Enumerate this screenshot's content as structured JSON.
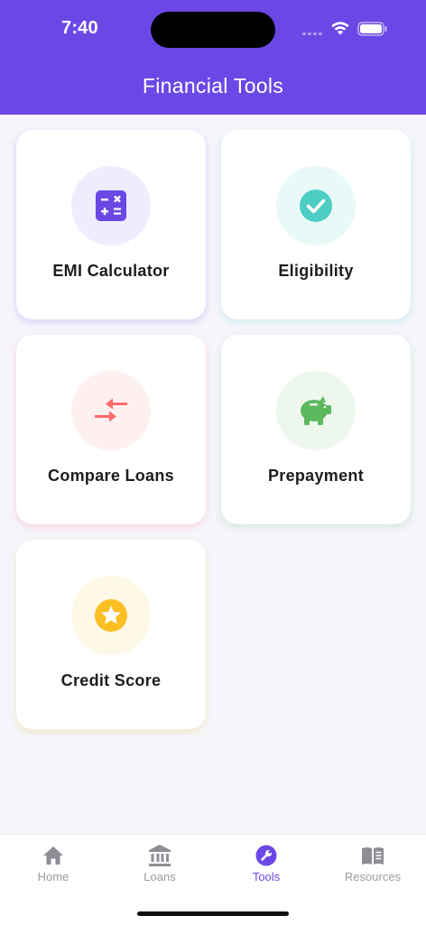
{
  "status_bar": {
    "time": "7:40"
  },
  "header": {
    "title": "Financial Tools"
  },
  "tools": [
    {
      "label": "EMI Calculator",
      "icon": "calculator-icon",
      "color": "#6b48e6",
      "bg": "#efecfd"
    },
    {
      "label": "Eligibility",
      "icon": "check-circle-icon",
      "color": "#4ecdc4",
      "bg": "#e8f9f7"
    },
    {
      "label": "Compare Loans",
      "icon": "compare-arrows-icon",
      "color": "#ff6b6b",
      "bg": "#fff0f0"
    },
    {
      "label": "Prepayment",
      "icon": "piggy-bank-icon",
      "color": "#5cb85c",
      "bg": "#edf7ed"
    },
    {
      "label": "Credit Score",
      "icon": "star-icon",
      "color": "#fbbf24",
      "bg": "#fef8e6"
    }
  ],
  "tab_bar": {
    "items": [
      {
        "label": "Home",
        "icon": "home-icon"
      },
      {
        "label": "Loans",
        "icon": "bank-icon"
      },
      {
        "label": "Tools",
        "icon": "wrench-icon"
      },
      {
        "label": "Resources",
        "icon": "book-icon"
      }
    ],
    "active": "Tools",
    "active_color": "#6b48e6",
    "inactive_color": "#9a9aa2"
  }
}
